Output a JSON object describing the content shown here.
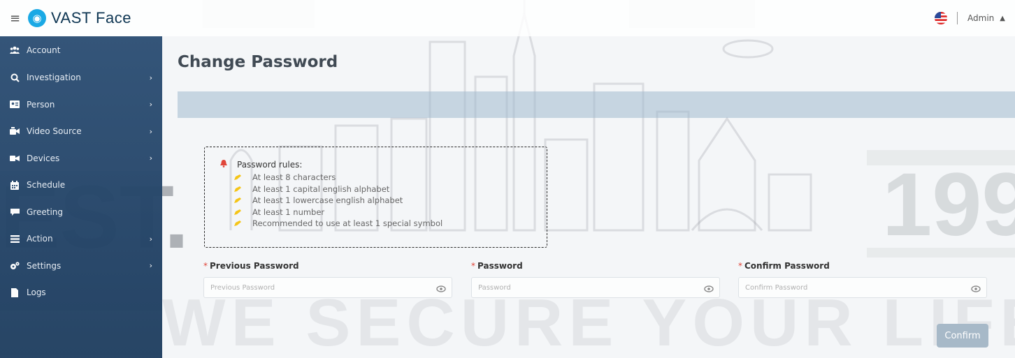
{
  "header": {
    "brand_text": "VAST Face",
    "user": "Admin",
    "language_flag": "us-flag-icon"
  },
  "sidebar": {
    "items": [
      {
        "label": "Account",
        "icon": "users-icon",
        "has_submenu": false
      },
      {
        "label": "Investigation",
        "icon": "search-icon",
        "has_submenu": true
      },
      {
        "label": "Person",
        "icon": "id-card-icon",
        "has_submenu": true
      },
      {
        "label": "Video Source",
        "icon": "video-source-icon",
        "has_submenu": true
      },
      {
        "label": "Devices",
        "icon": "camera-icon",
        "has_submenu": true
      },
      {
        "label": "Schedule",
        "icon": "calendar-icon",
        "has_submenu": false
      },
      {
        "label": "Greeting",
        "icon": "chat-icon",
        "has_submenu": false
      },
      {
        "label": "Action",
        "icon": "list-icon",
        "has_submenu": true
      },
      {
        "label": "Settings",
        "icon": "gears-icon",
        "has_submenu": true
      },
      {
        "label": "Logs",
        "icon": "file-icon",
        "has_submenu": false
      }
    ]
  },
  "main": {
    "title": "Change Password",
    "rules": {
      "heading": "Password rules:",
      "items": [
        "At least 8 characters",
        "At least 1 capital english alphabet",
        "At least 1 lowercase english alphabet",
        "At least 1 number",
        "Recommended to use at least 1 special symbol"
      ]
    },
    "fields": [
      {
        "label": "Previous Password",
        "placeholder": "Previous Password",
        "value": ""
      },
      {
        "label": "Password",
        "placeholder": "Password",
        "value": ""
      },
      {
        "label": "Confirm Password",
        "placeholder": "Confirm Password",
        "value": ""
      }
    ],
    "required_mark": "*",
    "confirm_label": "Confirm"
  },
  "watermark": {
    "slogan": "WE SECURE YOUR LIFE",
    "left_fragment": "EST.",
    "right_fragment": "199"
  },
  "colors": {
    "sidebar": "#2d4f74",
    "brand": "#1aa9e5",
    "button": "#a7b9c8",
    "required": "#e0463a",
    "bell": "#e0463a",
    "pencil": "#f5c518"
  }
}
